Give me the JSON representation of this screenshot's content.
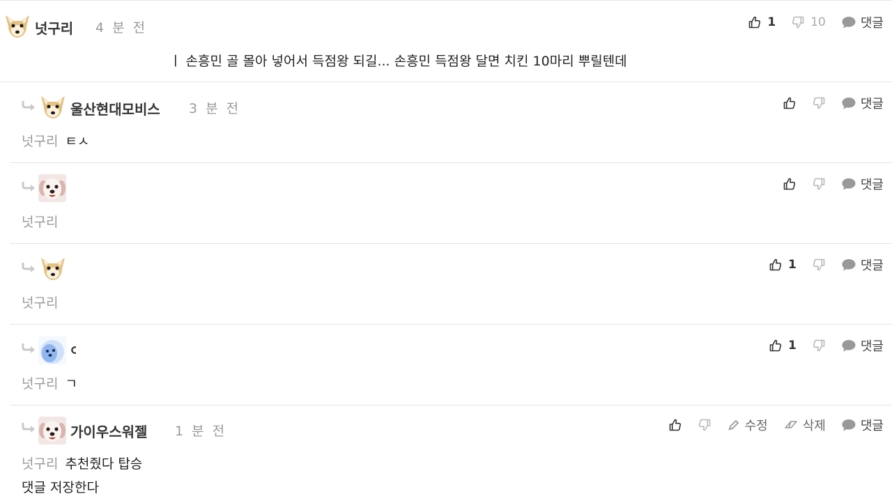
{
  "icons": {
    "like": "thumbs-up-icon",
    "dislike": "thumbs-down-icon",
    "reply": "speech-bubble-icon",
    "edit": "pencil-icon",
    "delete": "eraser-icon",
    "reply_arrow": "reply-arrow-icon"
  },
  "labels": {
    "reply": "댓글",
    "edit": "수정",
    "delete": "삭제"
  },
  "comments": [
    {
      "nickname": "넛구리",
      "time": "4 분 전",
      "text": "ㅣ 손흥민 골 몰아 넣어서 득점왕 되길... 손흥민 득점왕 달면 치킨 10마리 뿌릴텐데",
      "likes": "1",
      "dislikes": "10"
    },
    {
      "nickname": "울산현대모비스",
      "time": "3 분 전",
      "mention": "넛구리",
      "text": "ㅌㅅ"
    },
    {
      "mention": "넛구리"
    },
    {
      "likes": "1",
      "mention": "넛구리"
    },
    {
      "nickname": "ㅇ",
      "likes": "1",
      "mention": "넛구리",
      "text": "ㄱ"
    },
    {
      "nickname": "가이우스워젤",
      "time": "1 분 전",
      "mention": "넛구리",
      "text": "추천줬다 탑승",
      "text2": "댓글 저장한다"
    }
  ]
}
